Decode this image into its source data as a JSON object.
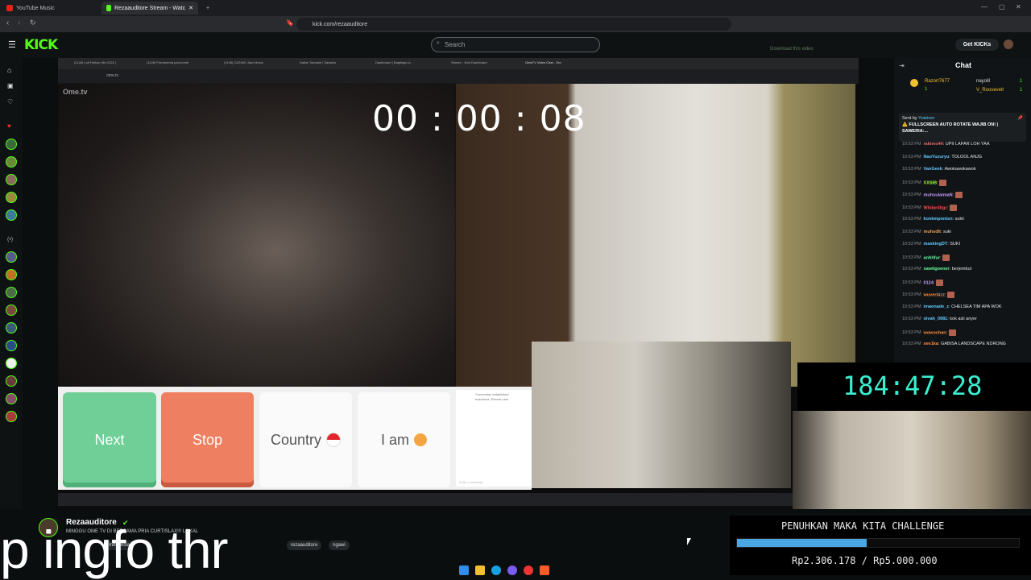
{
  "browser": {
    "tabs": [
      {
        "label": "YouTube Music",
        "color": "#e62117"
      },
      {
        "label": "Rezaauditore Stream - Watc",
        "color": "#53fc18"
      }
    ],
    "url": "kick.com/rezaauditore"
  },
  "kick": {
    "logo": "KICK",
    "search_placeholder": "Search",
    "get_kicks": "Get KICKs",
    "download_hint": "Download this video"
  },
  "stream": {
    "inner_tabs": [
      "(1148) Lofi Hiphop Mix 2022 |",
      "(1148) Ferramenta para tomb",
      "(1148) CASINO Jazz Music",
      "Daftar Tamadol | Sawaria",
      "Dashboard | Bagibagi.co",
      "Stream - Kick Dashboard",
      "OmeTV Video Chat - Om"
    ],
    "inner_url": "ome.tv",
    "ometv_logo": "Ome.tv",
    "timer": "00 : 00 : 08",
    "buttons": {
      "next": "Next",
      "stop": "Stop",
      "country": "Country",
      "iam": "I am"
    },
    "country_flag": "🇮🇩",
    "iam_emoji": "👦",
    "chat_note_1": "Connection established",
    "chat_note_2": "Indonesia. Recent user",
    "chat_input_placeholder": "Write a message"
  },
  "chat": {
    "title": "Chat",
    "top_gifter": "Razort7677",
    "top_gifter_count": "1",
    "gifters": [
      {
        "name": "nayoill",
        "count": "1"
      },
      {
        "name": "V_Roosevelt",
        "count": "1"
      }
    ],
    "pinned_by": "Sent by",
    "pinned_user": "Yuteiren",
    "pinned_text": "⚠️ FULLSCREEN AUTO ROTATE WAJIB ON! | SAWERIA:...",
    "messages": [
      {
        "time": "10:53 PM",
        "user": "rakimo44",
        "text": "UPII LAPAR LOH YAA",
        "color": "#e86f6f"
      },
      {
        "time": "10:53 PM",
        "user": "NaoYuzuryu",
        "text": "TOLOOL ANJG",
        "color": "#62c8ff"
      },
      {
        "time": "10:53 PM",
        "user": "VanGeek",
        "text": "Awokawokawok",
        "color": "#62c8ff"
      },
      {
        "time": "10:53 PM",
        "user": "XXSIB",
        "text": "",
        "emote": true,
        "color": "#a5ff3d"
      },
      {
        "time": "10:53 PM",
        "user": "muhsulaimaN",
        "text": "",
        "emote": true,
        "color": "#c69cff"
      },
      {
        "time": "10:53 PM",
        "user": "Wildardbgr",
        "text": "",
        "emote": true,
        "color": "#ff4d4d"
      },
      {
        "time": "10:53 PM",
        "user": "konkmpontsn",
        "text": "sukii",
        "color": "#62c8ff"
      },
      {
        "time": "10:53 PM",
        "user": "muhsdlt",
        "text": "suki",
        "color": "#f0a05a"
      },
      {
        "time": "10:53 PM",
        "user": "maskingDT",
        "text": "SUKI",
        "color": "#62c8ff"
      },
      {
        "time": "10:53 PM",
        "user": "anhhfur",
        "text": "",
        "emote": true,
        "color": "#62ff9c"
      },
      {
        "time": "10:53 PM",
        "user": "sawitgoener",
        "text": "berjembut",
        "color": "#62ff9c"
      },
      {
        "time": "10:53 PM",
        "user": "0124",
        "text": "",
        "emote": true,
        "color": "#c69cff"
      },
      {
        "time": "10:53 PM",
        "user": "wuverbizz",
        "text": "",
        "emote": true,
        "color": "#ff8d3b"
      },
      {
        "time": "10:53 PM",
        "user": "imaonade_z",
        "text": "CHELSEA TIM APA WOK",
        "color": "#62c8ff"
      },
      {
        "time": "10:53 PM",
        "user": "oivah_0981",
        "text": "kok asli anyer",
        "color": "#62c8ff"
      },
      {
        "time": "10:53 PM",
        "user": "wowochan",
        "text": "",
        "emote": true,
        "color": "#ff8d3b"
      },
      {
        "time": "10:53 PM",
        "user": "see1ka",
        "text": "GABISA LANDSCAPE NDRONG",
        "color": "#ff8d3b"
      }
    ]
  },
  "overlays": {
    "big_timer": "184:47:28",
    "challenge_title": "PENUHKAN MAKA KITA CHALLENGE",
    "challenge_amount": "Rp2.306.178 / Rp5.000.000",
    "challenge_progress": 0.461,
    "challenge_color": "#4aa6e0"
  },
  "caption": "p ingfo thr",
  "channel": {
    "name": "Rezaauditore",
    "title": "MINGGU OME TV DI BERSAMA PRIA CURTISLAX!!! LOKAL",
    "tags": [
      "Indonesia",
      "rezaauditore",
      "ngawi"
    ]
  },
  "accent": "#53fc18"
}
